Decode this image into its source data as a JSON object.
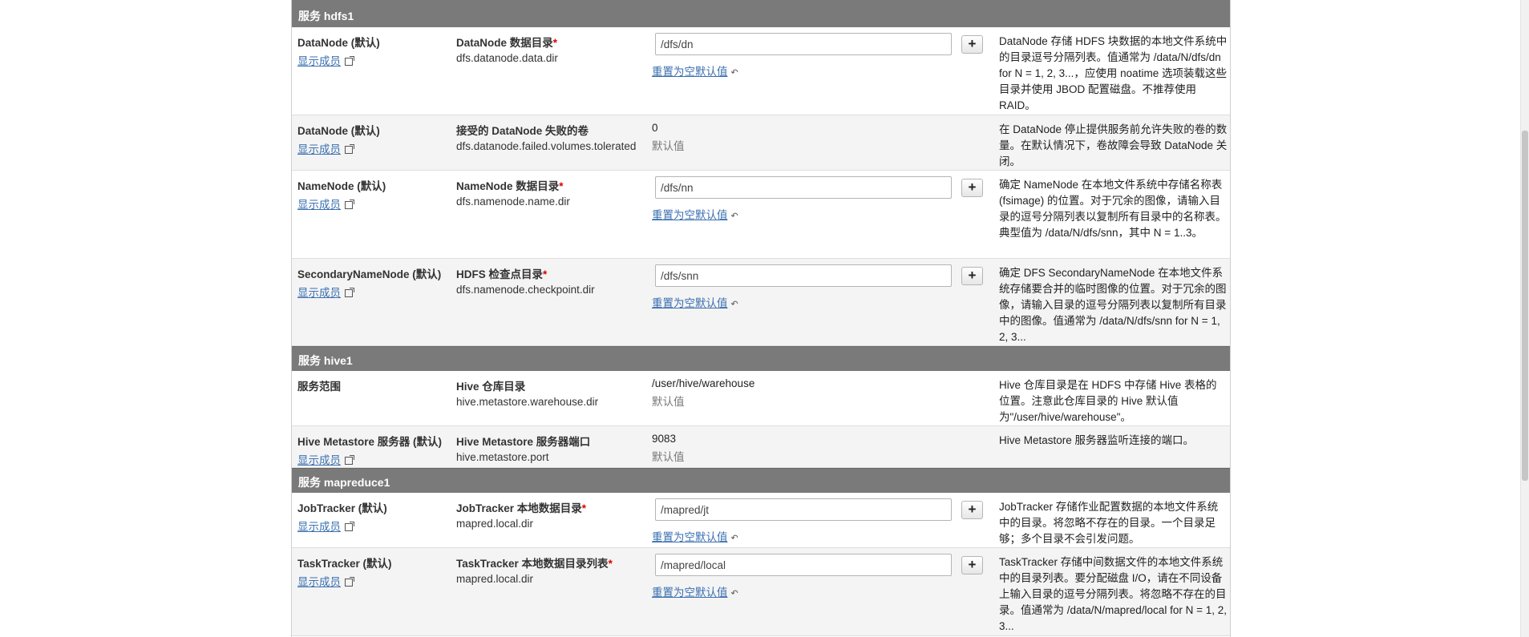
{
  "members_link": "显示成员",
  "reset_link": "重置为空默认值",
  "default_label": "默认值",
  "add_button": "+",
  "sections": [
    {
      "header": "服务 hdfs1",
      "rows": [
        {
          "scope": "DataNode (默认)",
          "members": true,
          "prop_label": "DataNode 数据目录",
          "required": true,
          "prop_key": "dfs.datanode.data.dir",
          "value_type": "input",
          "value": "/dfs/dn",
          "description": "DataNode 存储 HDFS 块数据的本地文件系统中的目录逗号分隔列表。值通常为 /data/N/dfs/dn for N = 1, 2, 3...，应使用 noatime 选项装载这些目录并使用 JBOD 配置磁盘。不推荐使用 RAID。"
        },
        {
          "scope": "DataNode (默认)",
          "members": true,
          "prop_label": "接受的 DataNode 失败的卷",
          "required": false,
          "prop_key": "dfs.datanode.failed.volumes.tolerated",
          "value_type": "static",
          "value": "0",
          "description": "在 DataNode 停止提供服务前允许失败的卷的数量。在默认情况下，卷故障会导致 DataNode 关闭。"
        },
        {
          "scope": "NameNode (默认)",
          "members": true,
          "prop_label": "NameNode 数据目录",
          "required": true,
          "prop_key": "dfs.namenode.name.dir",
          "value_type": "input",
          "value": "/dfs/nn",
          "description": "确定 NameNode 在本地文件系统中存储名称表 (fsimage) 的位置。对于冗余的图像，请输入目录的逗号分隔列表以复制所有目录中的名称表。典型值为 /data/N/dfs/snn，其中 N = 1..3。"
        },
        {
          "scope": "SecondaryNameNode (默认)",
          "members": true,
          "prop_label": "HDFS 检查点目录",
          "required": true,
          "prop_key": "dfs.namenode.checkpoint.dir",
          "value_type": "input",
          "value": "/dfs/snn",
          "description": "确定 DFS SecondaryNameNode 在本地文件系统存储要合并的临时图像的位置。对于冗余的图像，请输入目录的逗号分隔列表以复制所有目录中的图像。值通常为 /data/N/dfs/snn for N = 1, 2, 3..."
        }
      ]
    },
    {
      "header": "服务 hive1",
      "rows": [
        {
          "scope": "服务范围",
          "members": false,
          "prop_label": "Hive 仓库目录",
          "required": false,
          "prop_key": "hive.metastore.warehouse.dir",
          "value_type": "static",
          "value": "/user/hive/warehouse",
          "description": "Hive 仓库目录是在 HDFS 中存储 Hive 表格的位置。注意此仓库目录的 Hive 默认值为\"/user/hive/warehouse\"。"
        },
        {
          "scope": "Hive Metastore 服务器 (默认)",
          "members": true,
          "prop_label": "Hive Metastore 服务器端口",
          "required": false,
          "prop_key": "hive.metastore.port",
          "value_type": "static",
          "value": "9083",
          "description": "Hive Metastore 服务器监听连接的端口。"
        }
      ]
    },
    {
      "header": "服务 mapreduce1",
      "rows": [
        {
          "scope": "JobTracker (默认)",
          "members": true,
          "prop_label": "JobTracker 本地数据目录",
          "required": true,
          "prop_key": "mapred.local.dir",
          "value_type": "input",
          "value": "/mapred/jt",
          "description": "JobTracker 存储作业配置数据的本地文件系统中的目录。将忽略不存在的目录。一个目录足够；多个目录不会引发问题。"
        },
        {
          "scope": "TaskTracker (默认)",
          "members": true,
          "prop_label": "TaskTracker 本地数据目录列表",
          "required": true,
          "prop_key": "mapred.local.dir",
          "value_type": "input",
          "value": "/mapred/local",
          "description": "TaskTracker 存储中间数据文件的本地文件系统中的目录列表。要分配磁盘 I/O，请在不同设备上输入目录的逗号分隔列表。将忽略不存在的目录。值通常为 /data/N/mapred/local for N = 1, 2, 3..."
        }
      ]
    }
  ]
}
